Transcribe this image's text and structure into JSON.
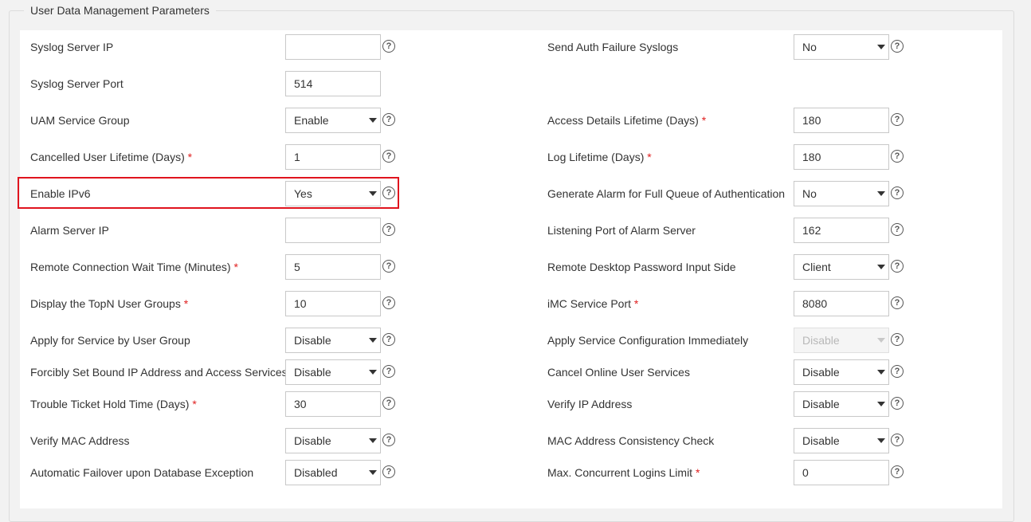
{
  "section_title": "User Data Management Parameters",
  "required_mark": "*",
  "help_glyph": "?",
  "left_fields": [
    {
      "label": "Syslog Server IP",
      "required": false,
      "type": "input",
      "value": "",
      "help": true
    },
    {
      "label": "Syslog Server Port",
      "required": false,
      "type": "input",
      "value": "514",
      "help": false
    },
    {
      "label": "UAM Service Group",
      "required": false,
      "type": "select",
      "value": "Enable",
      "help": true
    },
    {
      "label": "Cancelled User Lifetime (Days)",
      "required": true,
      "type": "input",
      "value": "1",
      "help": true
    },
    {
      "label": "Enable IPv6",
      "required": false,
      "type": "select",
      "value": "Yes",
      "help": true,
      "highlighted": true
    },
    {
      "label": "Alarm Server IP",
      "required": false,
      "type": "input",
      "value": "",
      "help": true
    },
    {
      "label": "Remote Connection Wait Time (Minutes)",
      "required": true,
      "type": "input",
      "value": "5",
      "help": true
    },
    {
      "label": "Display the TopN User Groups",
      "required": true,
      "type": "input",
      "value": "10",
      "help": true
    },
    {
      "label": "Apply for Service by User Group",
      "required": false,
      "type": "select",
      "value": "Disable",
      "help": true
    },
    {
      "label": "Forcibly Set Bound IP Address and Access Services",
      "required": false,
      "type": "select",
      "value": "Disable",
      "help": true
    },
    {
      "label": "Trouble Ticket Hold Time (Days)",
      "required": true,
      "type": "input",
      "value": "30",
      "help": true
    },
    {
      "label": "Verify MAC Address",
      "required": false,
      "type": "select",
      "value": "Disable",
      "help": true
    },
    {
      "label": "Automatic Failover upon Database Exception",
      "required": false,
      "type": "select",
      "value": "Disabled",
      "help": true
    }
  ],
  "right_fields": [
    {
      "label": "Send Auth Failure Syslogs",
      "required": false,
      "type": "select",
      "value": "No",
      "help": true
    },
    null,
    {
      "label": "Access Details Lifetime (Days)",
      "required": true,
      "type": "input",
      "value": "180",
      "help": true
    },
    {
      "label": "Log Lifetime (Days)",
      "required": true,
      "type": "input",
      "value": "180",
      "help": true
    },
    {
      "label": "Generate Alarm for Full Queue of Authentication",
      "required": false,
      "type": "select",
      "value": "No",
      "help": true
    },
    {
      "label": "Listening Port of Alarm Server",
      "required": false,
      "type": "input",
      "value": "162",
      "help": true
    },
    {
      "label": "Remote Desktop Password Input Side",
      "required": false,
      "type": "select",
      "value": "Client",
      "help": true
    },
    {
      "label": "iMC Service Port",
      "required": true,
      "type": "input",
      "value": "8080",
      "help": true
    },
    {
      "label": "Apply Service Configuration Immediately",
      "required": false,
      "type": "select",
      "value": "Disable",
      "help": true,
      "disabled": true
    },
    {
      "label": "Cancel Online User Services",
      "required": false,
      "type": "select",
      "value": "Disable",
      "help": true
    },
    {
      "label": "Verify IP Address",
      "required": false,
      "type": "select",
      "value": "Disable",
      "help": true
    },
    {
      "label": "MAC Address Consistency Check",
      "required": false,
      "type": "select",
      "value": "Disable",
      "help": true
    },
    {
      "label": "Max. Concurrent Logins Limit",
      "required": true,
      "type": "input",
      "value": "0",
      "help": true
    }
  ],
  "colors": {
    "required": "#e02020",
    "highlight": "#e0141e"
  }
}
